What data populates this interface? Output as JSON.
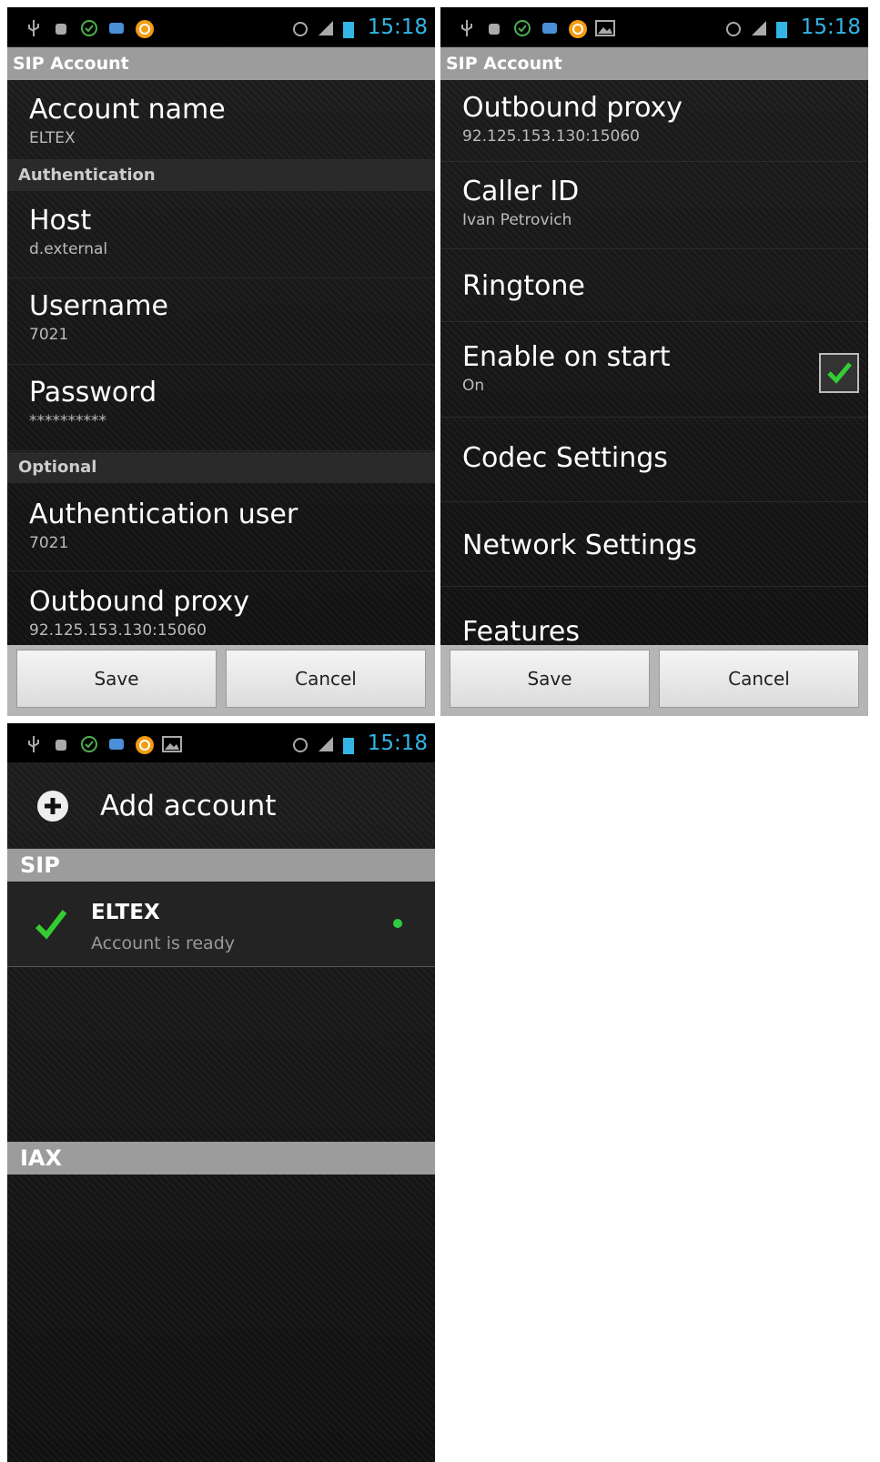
{
  "status_bar": {
    "time": "15:18"
  },
  "screen1": {
    "title": "SIP Account",
    "account_name": {
      "title": "Account name",
      "value": "ELTEX"
    },
    "section_auth": "Authentication",
    "host": {
      "title": "Host",
      "value": "d.external"
    },
    "username": {
      "title": "Username",
      "value": "7021"
    },
    "password": {
      "title": "Password",
      "value": "**********"
    },
    "section_optional": "Optional",
    "auth_user": {
      "title": "Authentication user",
      "value": "7021"
    },
    "outbound_proxy": {
      "title": "Outbound proxy",
      "value": "92.125.153.130:15060"
    },
    "save_label": "Save",
    "cancel_label": "Cancel"
  },
  "screen2": {
    "title": "SIP Account",
    "outbound_proxy": {
      "title": "Outbound proxy",
      "value": "92.125.153.130:15060"
    },
    "caller_id": {
      "title": "Caller ID",
      "value": "Ivan Petrovich"
    },
    "ringtone": {
      "title": "Ringtone"
    },
    "enable_on_start": {
      "title": "Enable on start",
      "value": "On",
      "checked": true
    },
    "codec_settings": {
      "title": "Codec Settings"
    },
    "network_settings": {
      "title": "Network Settings"
    },
    "features": {
      "title": "Features"
    },
    "save_label": "Save",
    "cancel_label": "Cancel"
  },
  "screen3": {
    "add_account_label": "Add account",
    "sip_header": "SIP",
    "account": {
      "name": "ELTEX",
      "status": "Account is ready"
    },
    "iax_header": "IAX"
  },
  "colors": {
    "accent": "#33b5e5",
    "check": "#33cc33",
    "ready_dot": "#2ecc40",
    "header_grey": "#9c9c9c"
  }
}
